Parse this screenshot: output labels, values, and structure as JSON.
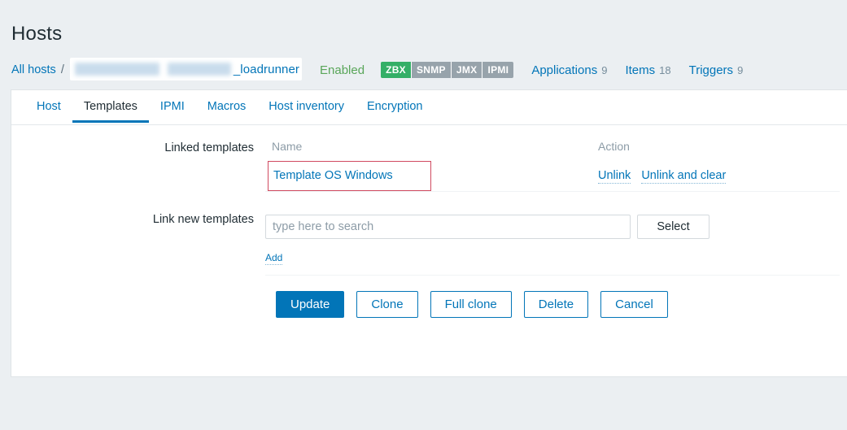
{
  "header": {
    "title": "Hosts"
  },
  "breadcrumb": {
    "all_hosts_label": "All hosts",
    "separator": "/",
    "host_name_suffix": "_loadrunner",
    "host_name_redacted": true,
    "status_label": "Enabled",
    "status_color": "#59a659"
  },
  "availability": {
    "badges": [
      {
        "label": "ZBX",
        "active": true
      },
      {
        "label": "SNMP",
        "active": false
      },
      {
        "label": "JMX",
        "active": false
      },
      {
        "label": "IPMI",
        "active": false
      }
    ],
    "active_color": "#34af67",
    "inactive_color": "#97a3ab"
  },
  "counts": [
    {
      "label": "Applications",
      "value": "9"
    },
    {
      "label": "Items",
      "value": "18"
    },
    {
      "label": "Triggers",
      "value": "9"
    }
  ],
  "tabs": [
    {
      "label": "Host",
      "active": false
    },
    {
      "label": "Templates",
      "active": true
    },
    {
      "label": "IPMI",
      "active": false
    },
    {
      "label": "Macros",
      "active": false
    },
    {
      "label": "Host inventory",
      "active": false
    },
    {
      "label": "Encryption",
      "active": false
    }
  ],
  "linked_templates": {
    "label": "Linked templates",
    "columns": {
      "name": "Name",
      "action": "Action"
    },
    "rows": [
      {
        "name": "Template OS Windows",
        "highlighted": true,
        "highlight_color": "#d04a60",
        "unlink_label": "Unlink",
        "unlink_clear_label": "Unlink and clear"
      }
    ]
  },
  "link_new_templates": {
    "label": "Link new templates",
    "search_placeholder": "type here to search",
    "search_value": "",
    "select_label": "Select",
    "add_label": "Add"
  },
  "footer": {
    "update_label": "Update",
    "clone_label": "Clone",
    "full_clone_label": "Full clone",
    "delete_label": "Delete",
    "cancel_label": "Cancel",
    "primary_color": "#0275b8"
  }
}
